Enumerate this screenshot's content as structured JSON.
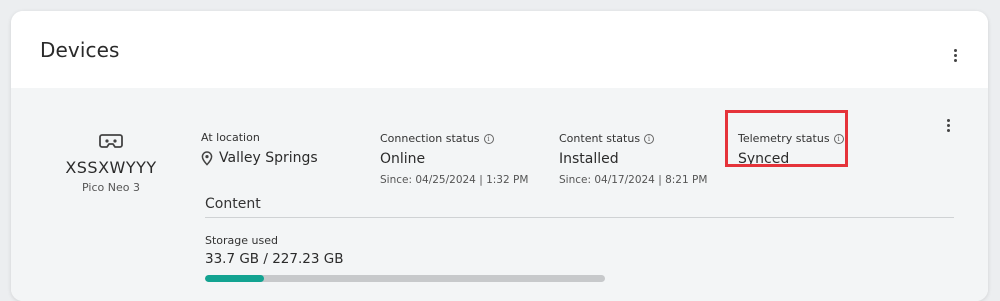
{
  "header": {
    "title": "Devices",
    "menu_icon": "kebab-menu-icon"
  },
  "device": {
    "icon": "vr-headset-icon",
    "name": "XSSXWYYY",
    "model": "Pico Neo 3",
    "location": {
      "label": "At location",
      "icon": "location-pin-icon",
      "value": "Valley Springs"
    },
    "connection": {
      "label": "Connection status",
      "value": "Online",
      "since": "Since: 04/25/2024 | 1:32 PM"
    },
    "content_status": {
      "label": "Content status",
      "value": "Installed",
      "since": "Since: 04/17/2024 | 8:21 PM"
    },
    "telemetry": {
      "label": "Telemetry status",
      "value": "Synced"
    },
    "highlight_color": "#e5333a"
  },
  "content": {
    "title": "Content",
    "storage_label": "Storage used",
    "storage_value": "33.7 GB / 227.23 GB",
    "storage_fraction": 0.148,
    "bar_color": "#12a391"
  }
}
